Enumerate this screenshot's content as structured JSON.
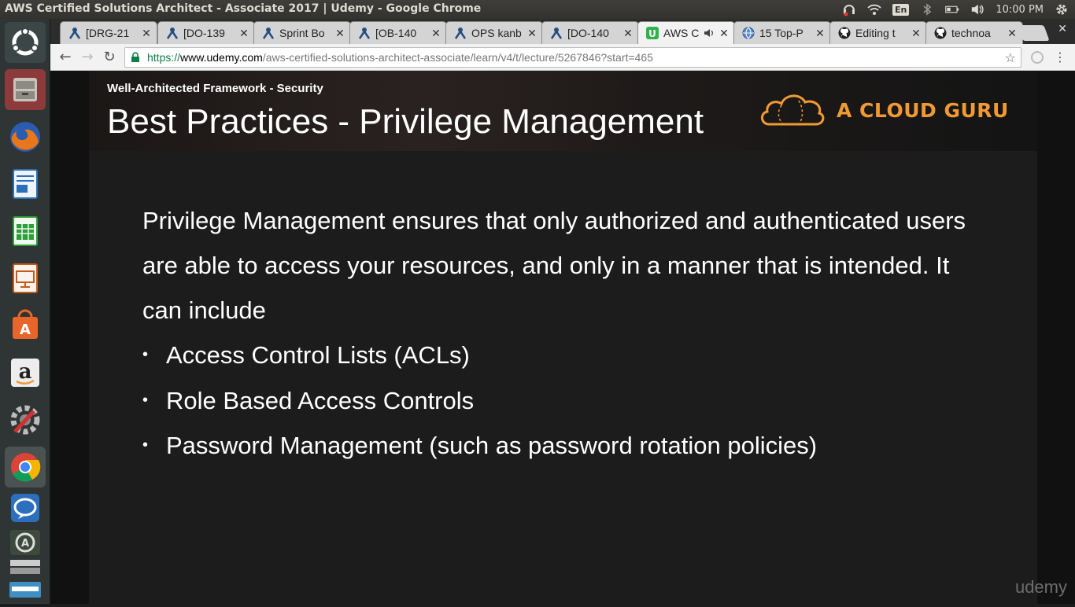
{
  "window": {
    "title": "AWS Certified Solutions Architect - Associate 2017 | Udemy - Google Chrome"
  },
  "tray": {
    "language": "En",
    "clock": "10:00 PM"
  },
  "launcher": {
    "items": [
      {
        "name": "ubuntu-dash-icon"
      },
      {
        "name": "files-icon"
      },
      {
        "name": "firefox-icon"
      },
      {
        "name": "writer-icon"
      },
      {
        "name": "calc-icon"
      },
      {
        "name": "impress-icon"
      },
      {
        "name": "software-center-icon"
      },
      {
        "name": "amazon-icon"
      },
      {
        "name": "system-settings-icon"
      },
      {
        "name": "chrome-icon"
      },
      {
        "name": "chat-icon"
      },
      {
        "name": "update-icon"
      },
      {
        "name": "stack-icon"
      },
      {
        "name": "workbench-icon"
      }
    ]
  },
  "tabs": [
    {
      "label": "[DRG-21",
      "icon": "jira-icon"
    },
    {
      "label": "[DO-139",
      "icon": "jira-icon"
    },
    {
      "label": "Sprint Bo",
      "icon": "jira-icon"
    },
    {
      "label": "[OB-140",
      "icon": "jira-icon"
    },
    {
      "label": "OPS kanb",
      "icon": "jira-icon"
    },
    {
      "label": "[DO-140",
      "icon": "jira-icon"
    },
    {
      "label": "AWS C",
      "icon": "udemy-icon",
      "active": true
    },
    {
      "label": "15 Top-P",
      "icon": "globe-icon"
    },
    {
      "label": "Editing t",
      "icon": "github-icon"
    },
    {
      "label": "technoa",
      "icon": "github-icon"
    }
  ],
  "address": {
    "scheme": "https://",
    "host": "www.udemy.com",
    "path": "/aws-certified-solutions-architect-associate/learn/v4/t/lecture/5267846?start=465"
  },
  "slide": {
    "subtitle": "Well-Architected Framework - Security",
    "title": "Best Practices - Privilege Management",
    "brand": "A CLOUD GURU",
    "body": "Privilege Management ensures that only authorized and authenticated users are able to access your resources, and only in a manner that is intended. It can include",
    "bullets": [
      "Access Control Lists (ACLs)",
      "Role Based Access Controls",
      "Password Management (such as password rotation policies)"
    ],
    "watermark": "udemy"
  },
  "colors": {
    "brand": "#f19a33",
    "secure": "#0b8043",
    "slide_bg": "#1c1c1c"
  }
}
